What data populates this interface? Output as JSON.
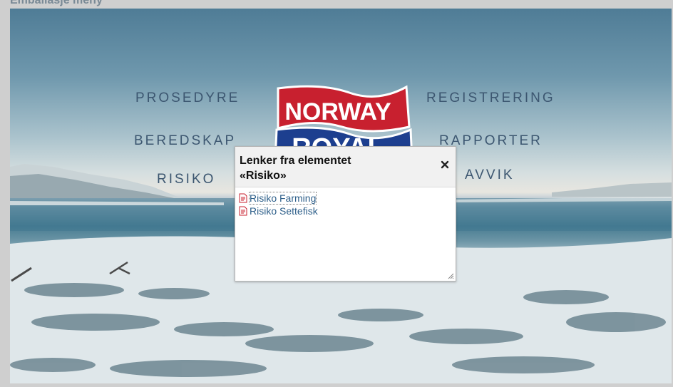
{
  "page": {
    "top_title": "Emballasje meny"
  },
  "menu": {
    "items": [
      {
        "label": "PROSEDYRE"
      },
      {
        "label": "REGISTRERING"
      },
      {
        "label": "BEREDSKAP"
      },
      {
        "label": "RAPPORTER"
      },
      {
        "label": "RISIKO"
      },
      {
        "label": "AVVIK"
      }
    ]
  },
  "logo": {
    "line1": "NORWAY",
    "line2": "ROYAL",
    "colors": {
      "red": "#c8202f",
      "blue": "#1d3f8f",
      "white": "#ffffff"
    }
  },
  "dialog": {
    "title_line1": "Lenker fra elementet",
    "title_line2": "«Risiko»",
    "close_icon": "close-icon",
    "links": [
      {
        "label": "Risiko Farming",
        "icon": "pdf-document-icon"
      },
      {
        "label": "Risiko Settefisk",
        "icon": "pdf-document-icon"
      }
    ]
  },
  "colors": {
    "menu_text": "#3c5670",
    "link_text": "#2e5f8a"
  }
}
